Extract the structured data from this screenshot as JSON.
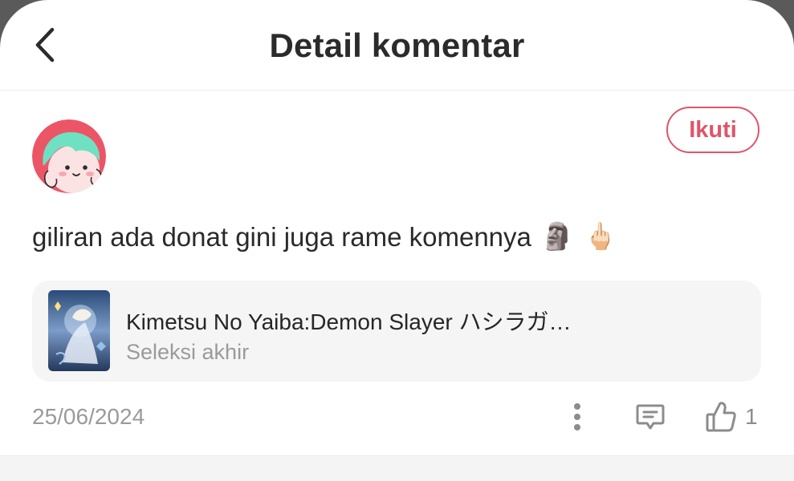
{
  "header": {
    "title": "Detail komentar"
  },
  "comment": {
    "follow_label": "Ikuti",
    "text": "giliran ada donat gini juga rame komennya",
    "emojis": [
      "🗿",
      "🖕🏻"
    ],
    "date": "25/06/2024",
    "like_count": "1"
  },
  "book": {
    "title": "Kimetsu No Yaiba:Demon Slayer ハシラガ…",
    "subtitle": "Seleksi akhir"
  },
  "icons": {
    "back": "chevron-left-icon",
    "more": "more-vertical-icon",
    "reply": "comment-icon",
    "like": "thumbs-up-icon"
  },
  "colors": {
    "accent": "#e0546a",
    "avatar_bg": "#ec5566",
    "hair": "#6fe0c2"
  }
}
